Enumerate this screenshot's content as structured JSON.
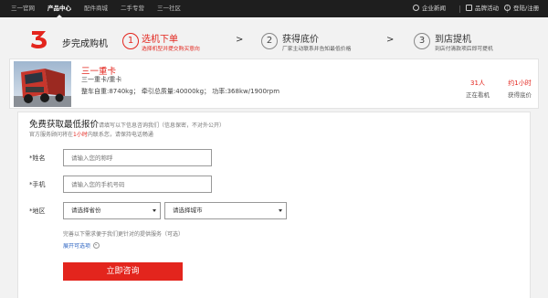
{
  "topnav": {
    "items": [
      {
        "label": "三一官网",
        "active": false
      },
      {
        "label": "产品中心",
        "active": true
      },
      {
        "label": "配件商城",
        "active": false
      },
      {
        "label": "二手专营",
        "active": false
      },
      {
        "label": "三一社区",
        "active": false
      }
    ],
    "right_links": {
      "news": "企业新闻",
      "events": "品牌活动",
      "login": "登陆/注册"
    }
  },
  "steps": {
    "logo_digit": "3",
    "title": "步完成购机",
    "items": [
      {
        "num": "1",
        "main": "选机下单",
        "sub": "选择机型并提交购买意向",
        "active": true
      },
      {
        "num": "2",
        "main": "获得底价",
        "sub": "厂家主动联系并告知最低价格",
        "active": false
      },
      {
        "num": "3",
        "main": "到店提机",
        "sub": "到店付清款项后即可提机",
        "active": false
      }
    ],
    "arrow": ">"
  },
  "product": {
    "name": "三一重卡",
    "subtitle": "三一重卡/重卡",
    "specs": "整车自重:8740kg；  牵引总质量:40000kg；  功率:368kw/1900rpm",
    "viewers_value": "31人",
    "viewers_label": "正在看机",
    "quote_value": "约1小时",
    "quote_label": "获得底价"
  },
  "form": {
    "title": "免费获取最低报价",
    "hint": "请填写以下信息咨询我们（信息保密，不对外公开）",
    "note_prefix": "官方服务顾问将在",
    "note_em": "1小时",
    "note_suffix": "内联系您，请保持电话畅通",
    "name_label": "*姓名",
    "name_placeholder": "请输入您的称呼",
    "phone_label": "*手机",
    "phone_placeholder": "请输入您的手机号码",
    "region_label": "*地区",
    "province_value": "请选择省份",
    "city_value": "请选择城市",
    "extra_note": "完善以下需求便于我们更针对的提供服务（可选）",
    "expand_label": "展开可选项",
    "submit_label": "立即咨询"
  },
  "colors": {
    "accent": "#e3251d",
    "nav_bg": "#1e1e1e",
    "link": "#2f66c2"
  }
}
